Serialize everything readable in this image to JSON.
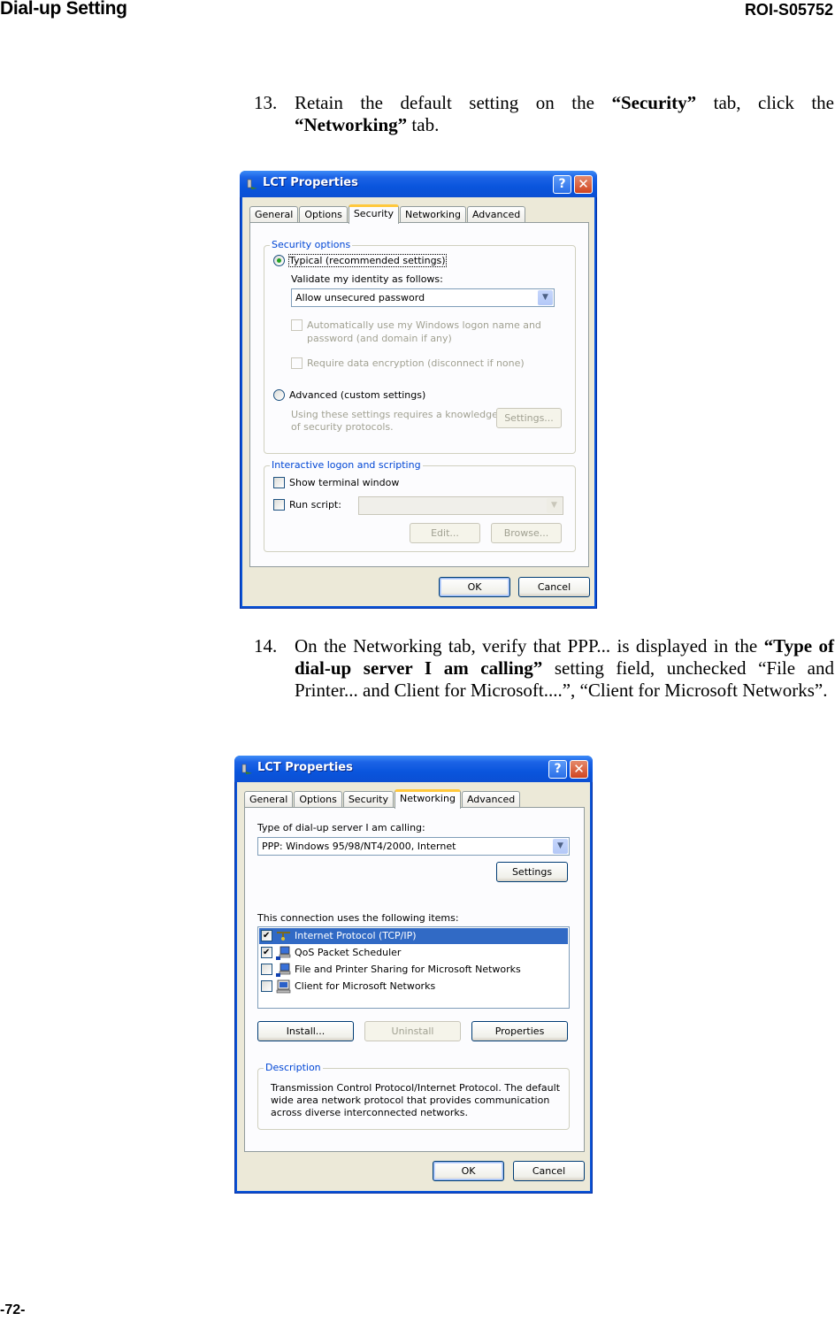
{
  "header": {
    "section": "Dial-up Setting",
    "doc_id": "ROI-S05752"
  },
  "footer": {
    "page": "-72-"
  },
  "steps": [
    {
      "num": "13.",
      "parts": [
        "Retain the default setting on the ",
        "“Security”",
        " tab, click the ",
        "“Networking”",
        " tab."
      ]
    },
    {
      "num": "14.",
      "parts": [
        "On the Networking tab, verify that PPP... is displayed in the ",
        "“Type of dial-up server I am calling”",
        " setting field, unchecked “File and Printer... and Client for Microsoft....”, “Client for Microsoft Networks”."
      ]
    }
  ],
  "dialog1": {
    "title": "LCT Properties",
    "help_button": "?",
    "close_button": "✕",
    "tabs": [
      "General",
      "Options",
      "Security",
      "Networking",
      "Advanced"
    ],
    "active_tab": "Security",
    "security_options": {
      "legend": "Security options",
      "typical_radio": {
        "label": "Typical (recommended settings)",
        "checked": true
      },
      "validate_label": "Validate my identity as follows:",
      "validate_value": "Allow unsecured password",
      "auto_logon": {
        "label_line1": "Automatically use my Windows logon name and",
        "label_line2": "password (and domain if any)",
        "checked": false,
        "enabled": false
      },
      "require_encryption": {
        "label": "Require data encryption (disconnect if none)",
        "checked": false,
        "enabled": false
      },
      "advanced_radio": {
        "label": "Advanced (custom settings)",
        "checked": false
      },
      "advanced_note_line1": "Using these settings requires a knowledge",
      "advanced_note_line2": "of security protocols.",
      "settings_button": "Settings..."
    },
    "interactive": {
      "legend": "Interactive logon and scripting",
      "show_terminal": {
        "label": "Show terminal window",
        "checked": false
      },
      "run_script": {
        "label": "Run script:",
        "checked": false
      },
      "script_value": "",
      "edit_button": "Edit...",
      "browse_button": "Browse..."
    },
    "ok_button": "OK",
    "cancel_button": "Cancel"
  },
  "dialog2": {
    "title": "LCT Properties",
    "help_button": "?",
    "close_button": "✕",
    "tabs": [
      "General",
      "Options",
      "Security",
      "Networking",
      "Advanced"
    ],
    "active_tab": "Networking",
    "server_type_label": "Type of dial-up server I am calling:",
    "server_type_value": "PPP: Windows 95/98/NT4/2000, Internet",
    "settings_button": "Settings",
    "items_label": "This connection uses the following items:",
    "items": [
      {
        "label": "Internet Protocol (TCP/IP)",
        "checked": true,
        "selected": true,
        "icon": "network-protocol-icon"
      },
      {
        "label": "QoS Packet Scheduler",
        "checked": true,
        "selected": false,
        "icon": "network-service-icon"
      },
      {
        "label": "File and Printer Sharing for Microsoft Networks",
        "checked": false,
        "selected": false,
        "icon": "network-service-icon"
      },
      {
        "label": "Client for Microsoft Networks",
        "checked": false,
        "selected": false,
        "icon": "network-client-icon"
      }
    ],
    "install_button": "Install...",
    "uninstall_button": "Uninstall",
    "properties_button": "Properties",
    "description_legend": "Description",
    "description_lines": [
      "Transmission Control Protocol/Internet Protocol. The default",
      "wide area network protocol that provides communication",
      "across diverse interconnected networks."
    ],
    "ok_button": "OK",
    "cancel_button": "Cancel"
  },
  "colors": {
    "xp_title_blue": "#0a55dd",
    "group_legend_blue": "#0046d5",
    "selection_blue": "#316ac5",
    "active_tab_orange": "#ffc83c",
    "dialog_bg": "#ece9d8"
  }
}
